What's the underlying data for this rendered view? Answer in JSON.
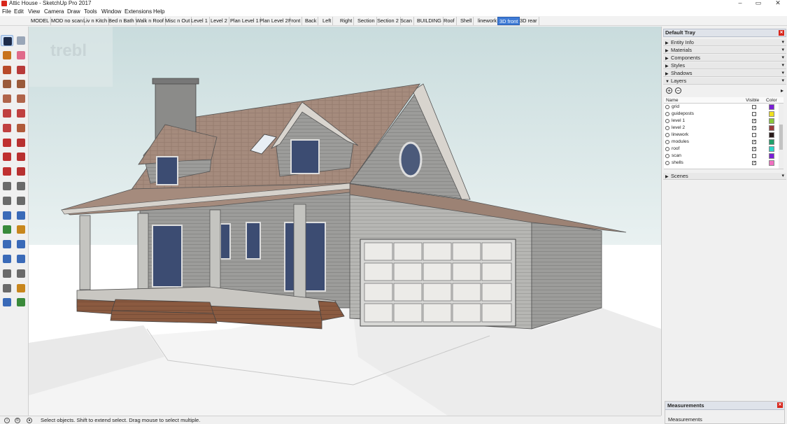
{
  "window": {
    "title": "Attic House - SketchUp Pro 2017",
    "controls": {
      "minimize": "–",
      "maximize": "▭",
      "close": "✕"
    }
  },
  "menu": [
    "File",
    "Edit",
    "View",
    "Camera",
    "Draw",
    "Tools",
    "Window",
    "Extensions",
    "Help"
  ],
  "scenes": {
    "tabs": [
      "MODEL",
      "MOD no scan",
      "Liv n Kitch",
      "Bed n Bath",
      "Walk n Roof",
      "Misc n Out",
      "Level 1",
      "Level 2",
      "Plan Level 1",
      "Plan Level 2",
      "Front",
      "Back",
      "Left",
      "Right",
      "Section",
      "Section 2",
      "Scan",
      "BUILDING",
      "Roof",
      "Shell",
      "linework",
      "3D front",
      "3D rear"
    ],
    "active": "3D front"
  },
  "toolbar": {
    "tools": [
      {
        "icon": "select-arrow-icon",
        "color": "#1d2b4a"
      },
      {
        "icon": "make-component-icon",
        "color": "#9aa6b8"
      },
      {
        "icon": "paint-bucket-icon",
        "color": "#c8731c"
      },
      {
        "icon": "eraser-icon",
        "color": "#e06a8a"
      },
      {
        "icon": "line-pencil-icon",
        "color": "#b84a2a"
      },
      {
        "icon": "freehand-icon",
        "color": "#b83a3a"
      },
      {
        "icon": "rectangle-icon",
        "color": "#9a5a3a"
      },
      {
        "icon": "rotated-rectangle-icon",
        "color": "#9a5a3a"
      },
      {
        "icon": "circle-icon",
        "color": "#b0644a"
      },
      {
        "icon": "polygon-icon",
        "color": "#b0644a"
      },
      {
        "icon": "arc-icon",
        "color": "#c04040"
      },
      {
        "icon": "pie-icon",
        "color": "#c04040"
      },
      {
        "icon": "three-point-arc-icon",
        "color": "#c04040"
      },
      {
        "icon": "two-point-arc-icon",
        "color": "#b05a3a"
      },
      {
        "icon": "move-icon",
        "color": "#c03030"
      },
      {
        "icon": "push-pull-icon",
        "color": "#b83030"
      },
      {
        "icon": "rotate-icon",
        "color": "#c03030"
      },
      {
        "icon": "follow-me-icon",
        "color": "#b83030"
      },
      {
        "icon": "scale-icon",
        "color": "#c03030"
      },
      {
        "icon": "offset-icon",
        "color": "#b83030"
      },
      {
        "icon": "tape-measure-icon",
        "color": "#6a6a6a"
      },
      {
        "icon": "dimension-icon",
        "color": "#6a6a6a"
      },
      {
        "icon": "protractor-icon",
        "color": "#6a6a6a"
      },
      {
        "icon": "text-icon",
        "color": "#6a6a6a"
      },
      {
        "icon": "axes-icon",
        "color": "#3a6ab8"
      },
      {
        "icon": "3d-text-icon",
        "color": "#3a6ab8"
      },
      {
        "icon": "orbit-icon",
        "color": "#3a8a3a"
      },
      {
        "icon": "pan-icon",
        "color": "#c8861c"
      },
      {
        "icon": "zoom-icon",
        "color": "#3a6ab8"
      },
      {
        "icon": "zoom-window-icon",
        "color": "#3a6ab8"
      },
      {
        "icon": "zoom-extents-icon",
        "color": "#3a6ab8"
      },
      {
        "icon": "previous-view-icon",
        "color": "#3a6ab8"
      },
      {
        "icon": "position-camera-icon",
        "color": "#6a6a6a"
      },
      {
        "icon": "look-around-icon",
        "color": "#6a6a6a"
      },
      {
        "icon": "walk-icon",
        "color": "#6a6a6a"
      },
      {
        "icon": "section-plane-icon",
        "color": "#c8861c"
      },
      {
        "icon": "geo-location-icon",
        "color": "#3a6ab8"
      },
      {
        "icon": "add-location-icon",
        "color": "#3a8a3a"
      }
    ]
  },
  "viewport": {
    "watermark": "trebl"
  },
  "tray": {
    "title": "Default Tray",
    "panels": [
      {
        "label": "Entity Info",
        "expanded": false
      },
      {
        "label": "Materials",
        "expanded": false
      },
      {
        "label": "Components",
        "expanded": false
      },
      {
        "label": "Styles",
        "expanded": false
      },
      {
        "label": "Shadows",
        "expanded": false
      },
      {
        "label": "Layers",
        "expanded": true
      }
    ],
    "layers": {
      "add_label": "+",
      "remove_label": "−",
      "details_label": "▸",
      "col_name": "Name",
      "col_visible": "Visible",
      "col_color": "Color",
      "rows": [
        {
          "name": "grid",
          "visible": false,
          "color": "#7a1fd6"
        },
        {
          "name": "guideposts",
          "visible": false,
          "color": "#f0e020"
        },
        {
          "name": "level 1",
          "visible": true,
          "color": "#8ac83a"
        },
        {
          "name": "level 2",
          "visible": true,
          "color": "#9a3a3a"
        },
        {
          "name": "linework",
          "visible": false,
          "color": "#2a1a1a"
        },
        {
          "name": "modules",
          "visible": true,
          "color": "#1fa06a"
        },
        {
          "name": "roof",
          "visible": true,
          "color": "#2ad6c8"
        },
        {
          "name": "scan",
          "visible": false,
          "color": "#7a1fd6"
        },
        {
          "name": "shells",
          "visible": true,
          "color": "#f070c0"
        }
      ]
    },
    "scenes_label": "Scenes"
  },
  "measurements": {
    "title": "Measurements",
    "label": "Measurements"
  },
  "status": {
    "text": "Select objects. Shift to extend select. Drag mouse to select multiple."
  }
}
